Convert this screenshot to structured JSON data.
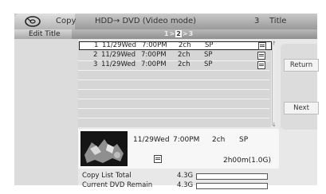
{
  "header": {
    "copy_label": "Copy",
    "mode": "HDD→ DVD (Video mode)",
    "title_count": "3",
    "title_label": "Title"
  },
  "subheader": {
    "edit_title": "Edit Title",
    "pages": [
      "1",
      ">",
      "2",
      ">",
      "3"
    ]
  },
  "list": {
    "rows": [
      {
        "num": "1",
        "date": "11/29Wed",
        "time": "7:00PM",
        "ch": "2ch",
        "mode": "SP",
        "selected": true
      },
      {
        "num": "2",
        "date": "11/29Wed",
        "time": "7:00PM",
        "ch": "2ch",
        "mode": "SP",
        "selected": false
      },
      {
        "num": "3",
        "date": "11/29Wed",
        "time": "7:00PM",
        "ch": "2ch",
        "mode": "SP",
        "selected": false
      }
    ]
  },
  "buttons": {
    "return": "Return",
    "next": "Next"
  },
  "detail": {
    "date": "11/29Wed",
    "time": "7:00PM",
    "ch": "2ch",
    "mode": "SP",
    "duration": "2h00m(1.0G)"
  },
  "footer": {
    "copy_list_total_label": "Copy List Total",
    "copy_list_total_value": "4.3G",
    "current_dvd_remain_label": "Current DVD Remain",
    "current_dvd_remain_value": "4.3G"
  },
  "icons": {
    "disc": "disc-icon",
    "memo": "memo-icon",
    "scroll_up": "chevron-up-icon",
    "scroll_down": "chevron-down-icon"
  }
}
